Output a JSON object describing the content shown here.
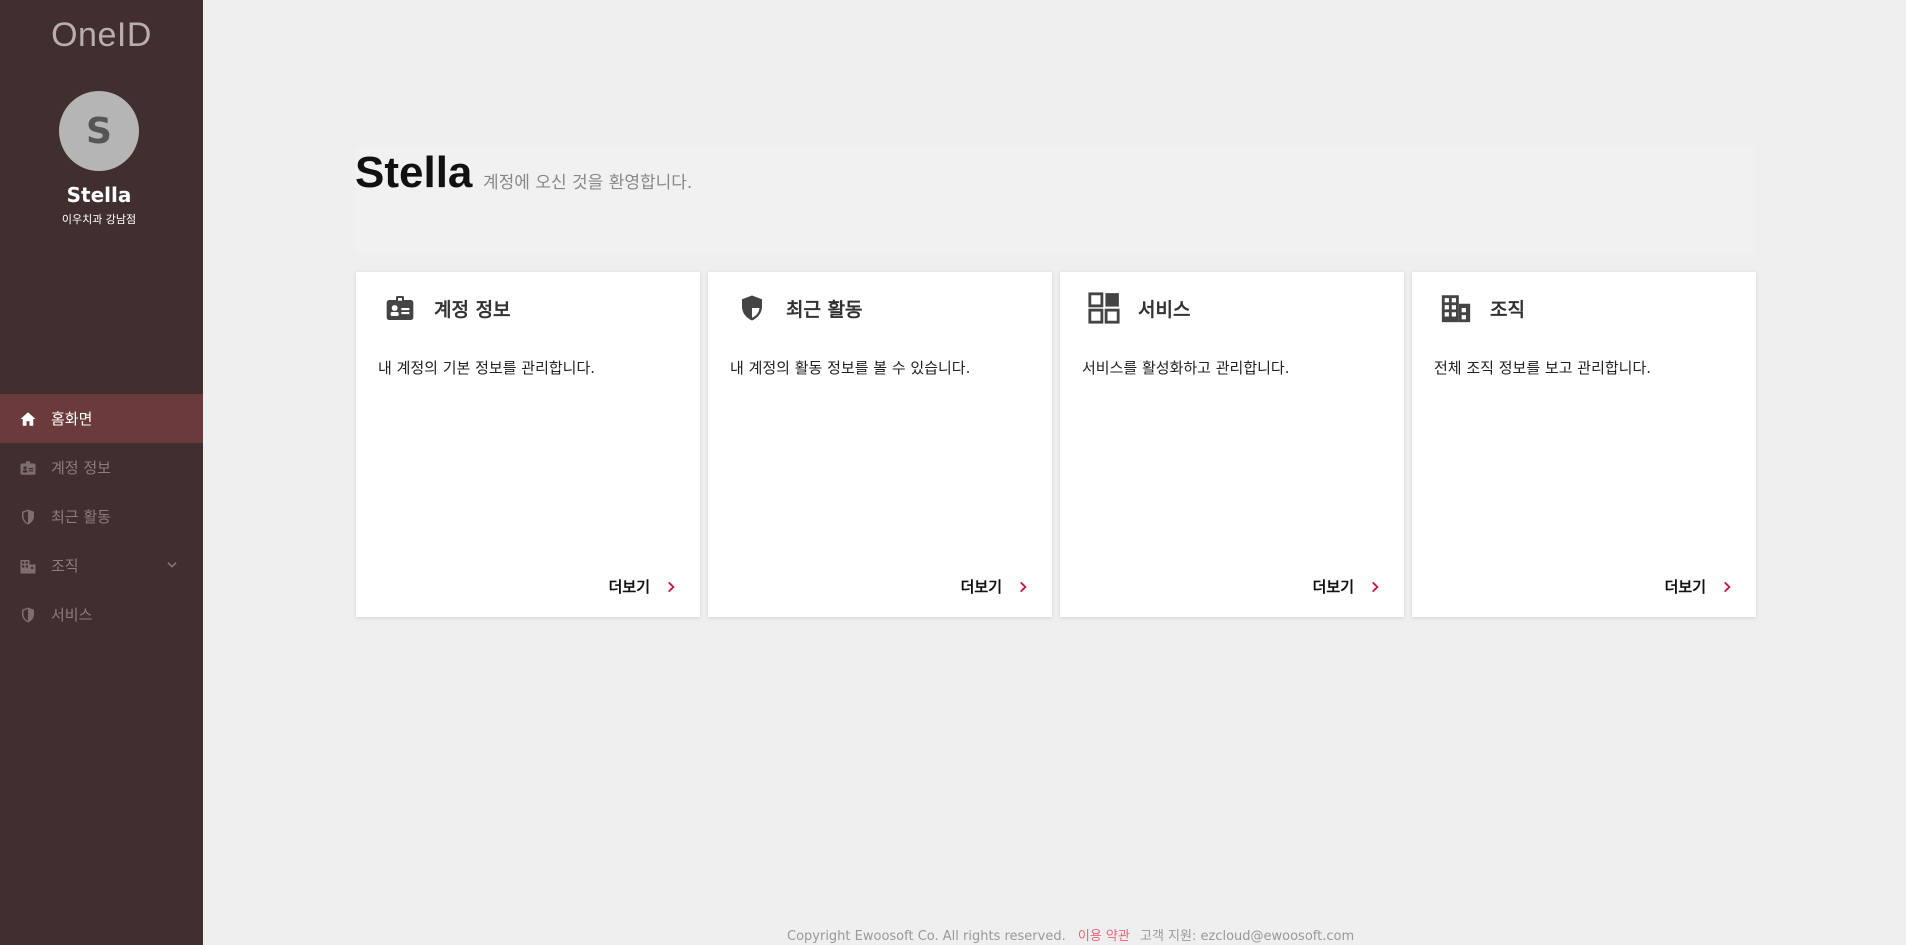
{
  "sidebar": {
    "logo": "OneID",
    "avatar_initial": "S",
    "user_name": "Stella",
    "user_org": "이우치과 강남점",
    "items": [
      {
        "label": "홈화면",
        "icon": "home-icon",
        "active": true
      },
      {
        "label": "계정 정보",
        "icon": "id-badge-icon",
        "active": false
      },
      {
        "label": "최근 활동",
        "icon": "shield-icon",
        "active": false
      },
      {
        "label": "조직",
        "icon": "building-icon",
        "active": false
      },
      {
        "label": "서비스",
        "icon": "shield-icon",
        "active": false
      }
    ]
  },
  "welcome": {
    "name": "Stella",
    "message": "계정에 오신 것을 환영합니다."
  },
  "cards": [
    {
      "title": "계정 정보",
      "desc": "내 계정의 기본 정보를 관리합니다.",
      "more": "더보기",
      "icon": "id-badge-icon"
    },
    {
      "title": "최근 활동",
      "desc": "내 계정의 활동 정보를 볼 수 있습니다.",
      "more": "더보기",
      "icon": "shield-icon"
    },
    {
      "title": "서비스",
      "desc": "서비스를 활성화하고 관리합니다.",
      "more": "더보기",
      "icon": "grid-icon"
    },
    {
      "title": "조직",
      "desc": "전체 조직 정보를 보고 관리합니다.",
      "more": "더보기",
      "icon": "building-icon"
    }
  ],
  "footer": {
    "copyright": "Copyright Ewoosoft Co. All rights reserved.",
    "terms": "이용 약관",
    "support": "고객 지원: ezcloud@ewoosoft.com"
  },
  "colors": {
    "sidebar_bg": "#412f2f",
    "active_bg": "#6b3a3a",
    "accent": "#c8102e"
  }
}
